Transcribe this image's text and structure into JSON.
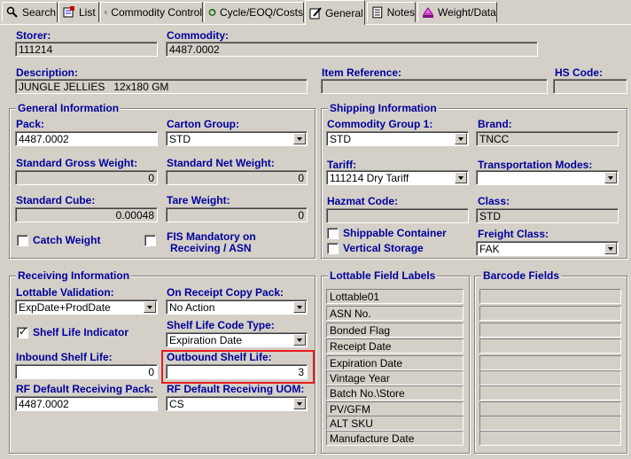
{
  "tabs": [
    {
      "label": "Search",
      "icon": "search-icon"
    },
    {
      "label": "List",
      "icon": "list-icon"
    },
    {
      "label": "Commodity Control",
      "icon": "commodity-control-icon"
    },
    {
      "label": "Cycle/EOQ/Costs",
      "icon": "cycle-icon"
    },
    {
      "label": "General",
      "icon": "general-icon"
    },
    {
      "label": "Notes",
      "icon": "notes-icon"
    },
    {
      "label": "Weight/Data",
      "icon": "weight-icon"
    }
  ],
  "active_tab": "General",
  "header": {
    "storer_label": "Storer:",
    "storer_value": "111214",
    "commodity_label": "Commodity:",
    "commodity_value": "4487.0002",
    "description_label": "Description:",
    "description_value": "JUNGLE JELLIES   12x180 GM",
    "item_reference_label": "Item Reference:",
    "item_reference_value": "",
    "hs_code_label": "HS Code:",
    "hs_code_value": ""
  },
  "general": {
    "title": "General Information",
    "pack_label": "Pack:",
    "pack_value": "4487.0002",
    "carton_group_label": "Carton Group:",
    "carton_group_value": "STD",
    "gross_weight_label": "Standard Gross Weight:",
    "gross_weight_value": "0",
    "net_weight_label": "Standard Net Weight:",
    "net_weight_value": "0",
    "cube_label": "Standard Cube:",
    "cube_value": "0.00048",
    "tare_weight_label": "Tare Weight:",
    "tare_weight_value": "0",
    "catch_weight_label": "Catch Weight",
    "catch_weight_checked": false,
    "fis_label_line1": "FIS Mandatory on",
    "fis_label_line2": "Receiving / ASN",
    "fis_checked": false
  },
  "shipping": {
    "title": "Shipping Information",
    "commodity_group_label": "Commodity Group 1:",
    "commodity_group_value": "STD",
    "brand_label": "Brand:",
    "brand_value": "TNCC",
    "tariff_label": "Tariff:",
    "tariff_value": "111214 Dry Tariff",
    "transport_label": "Transportation Modes:",
    "transport_value": "",
    "hazmat_label": "Hazmat Code:",
    "hazmat_value": "",
    "class_label": "Class:",
    "class_value": "STD",
    "shippable_label": "Shippable Container",
    "shippable_checked": false,
    "vertical_label": "Vertical Storage",
    "vertical_checked": false,
    "freight_label": "Freight Class:",
    "freight_value": "FAK"
  },
  "receiving": {
    "title": "Receiving Information",
    "lottable_validation_label": "Lottable Validation:",
    "lottable_validation_value": "ExpDate+ProdDate",
    "copy_pack_label": "On Receipt Copy Pack:",
    "copy_pack_value": "No Action",
    "shelf_life_indicator_label": "Shelf Life Indicator",
    "shelf_life_indicator_checked": true,
    "shelf_life_code_label": "Shelf Life Code Type:",
    "shelf_life_code_value": "Expiration Date",
    "inbound_label": "Inbound Shelf Life:",
    "inbound_value": "0",
    "outbound_label": "Outbound Shelf Life:",
    "outbound_value": "3",
    "rf_pack_label": "RF Default Receiving Pack:",
    "rf_pack_value": "4487.0002",
    "rf_uom_label": "RF Default Receiving UOM:",
    "rf_uom_value": "CS"
  },
  "lottable": {
    "title": "Lottable Field Labels",
    "items": [
      "Lottable01",
      "ASN No.",
      "Bonded Flag",
      "Receipt Date",
      "Expiration Date",
      "Vintage Year",
      "Batch No.\\Store",
      "PV/GFM",
      "ALT SKU",
      "Manufacture Date"
    ]
  },
  "barcode": {
    "title": "Barcode Fields",
    "items": [
      "",
      "",
      "",
      "",
      "",
      "",
      "",
      "",
      "",
      ""
    ]
  },
  "colors": {
    "label": "#00009c",
    "panel": "#d4d0c8",
    "highlight": "#e81c1c"
  }
}
